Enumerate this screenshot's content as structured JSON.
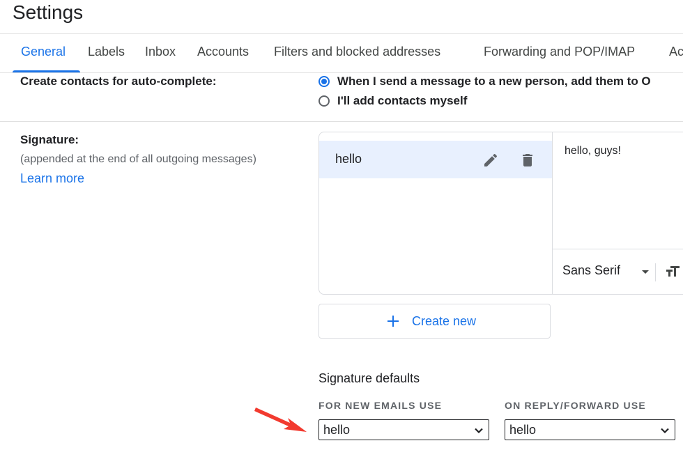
{
  "page": {
    "title": "Settings"
  },
  "tabs": [
    {
      "label": "General",
      "active": true
    },
    {
      "label": "Labels"
    },
    {
      "label": "Inbox"
    },
    {
      "label": "Accounts"
    },
    {
      "label": "Filters and blocked addresses"
    },
    {
      "label": "Forwarding and POP/IMAP"
    },
    {
      "label": "Ac"
    }
  ],
  "autocomplete": {
    "label": "Create contacts for auto-complete:",
    "options": [
      {
        "label": "When I send a message to a new person, add them to O",
        "checked": true
      },
      {
        "label": "I'll add contacts myself",
        "checked": false
      }
    ]
  },
  "signature": {
    "title": "Signature:",
    "subtitle": "(appended at the end of all outgoing messages)",
    "learn_more": "Learn more",
    "items": [
      {
        "name": "hello"
      }
    ],
    "editor_text": "hello, guys!",
    "font": "Sans Serif",
    "create_new": "Create new",
    "defaults_title": "Signature defaults",
    "new_emails_label": "FOR NEW EMAILS USE",
    "new_emails_value": "hello",
    "reply_label": "ON REPLY/FORWARD USE",
    "reply_value": "hello"
  },
  "colors": {
    "accent": "#1a73e8",
    "selected_bg": "#e8f0fe",
    "annotation_arrow": "#f23a2f"
  },
  "icons": [
    "pencil-icon",
    "trash-icon",
    "text-size-icon",
    "plus-icon",
    "chevron-down-icon",
    "red-arrow-icon"
  ]
}
